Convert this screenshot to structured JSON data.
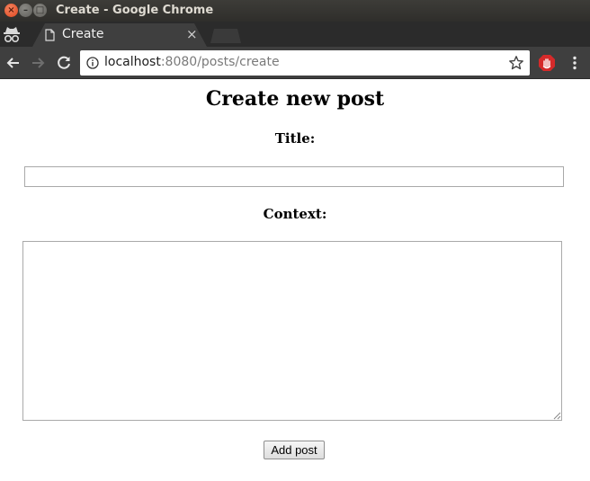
{
  "window": {
    "title": "Create - Google Chrome",
    "close_glyph": "×",
    "min_glyph": "–",
    "max_glyph": "□"
  },
  "browser": {
    "tab_title": "Create",
    "tab_close_glyph": "×",
    "url_host": "localhost",
    "url_rest": ":8080/posts/create",
    "icons": {
      "incognito": "incognito-icon",
      "tab_favicon": "file-icon",
      "back": "back-arrow-icon",
      "forward": "forward-arrow-icon",
      "reload": "reload-icon",
      "site_info": "info-icon",
      "bookmark": "star-icon",
      "extension": "stop-hand-extension-icon",
      "menu": "kebab-menu-icon"
    },
    "colors": {
      "titlebar": "#2f2e2b",
      "close_button": "#e0461f",
      "tab": "#3f3f3f",
      "extension": "#d52a2a"
    }
  },
  "form": {
    "heading": "Create new post",
    "title_label": "Title:",
    "title_value": "",
    "context_label": "Context:",
    "context_value": "",
    "submit_label": "Add post"
  }
}
